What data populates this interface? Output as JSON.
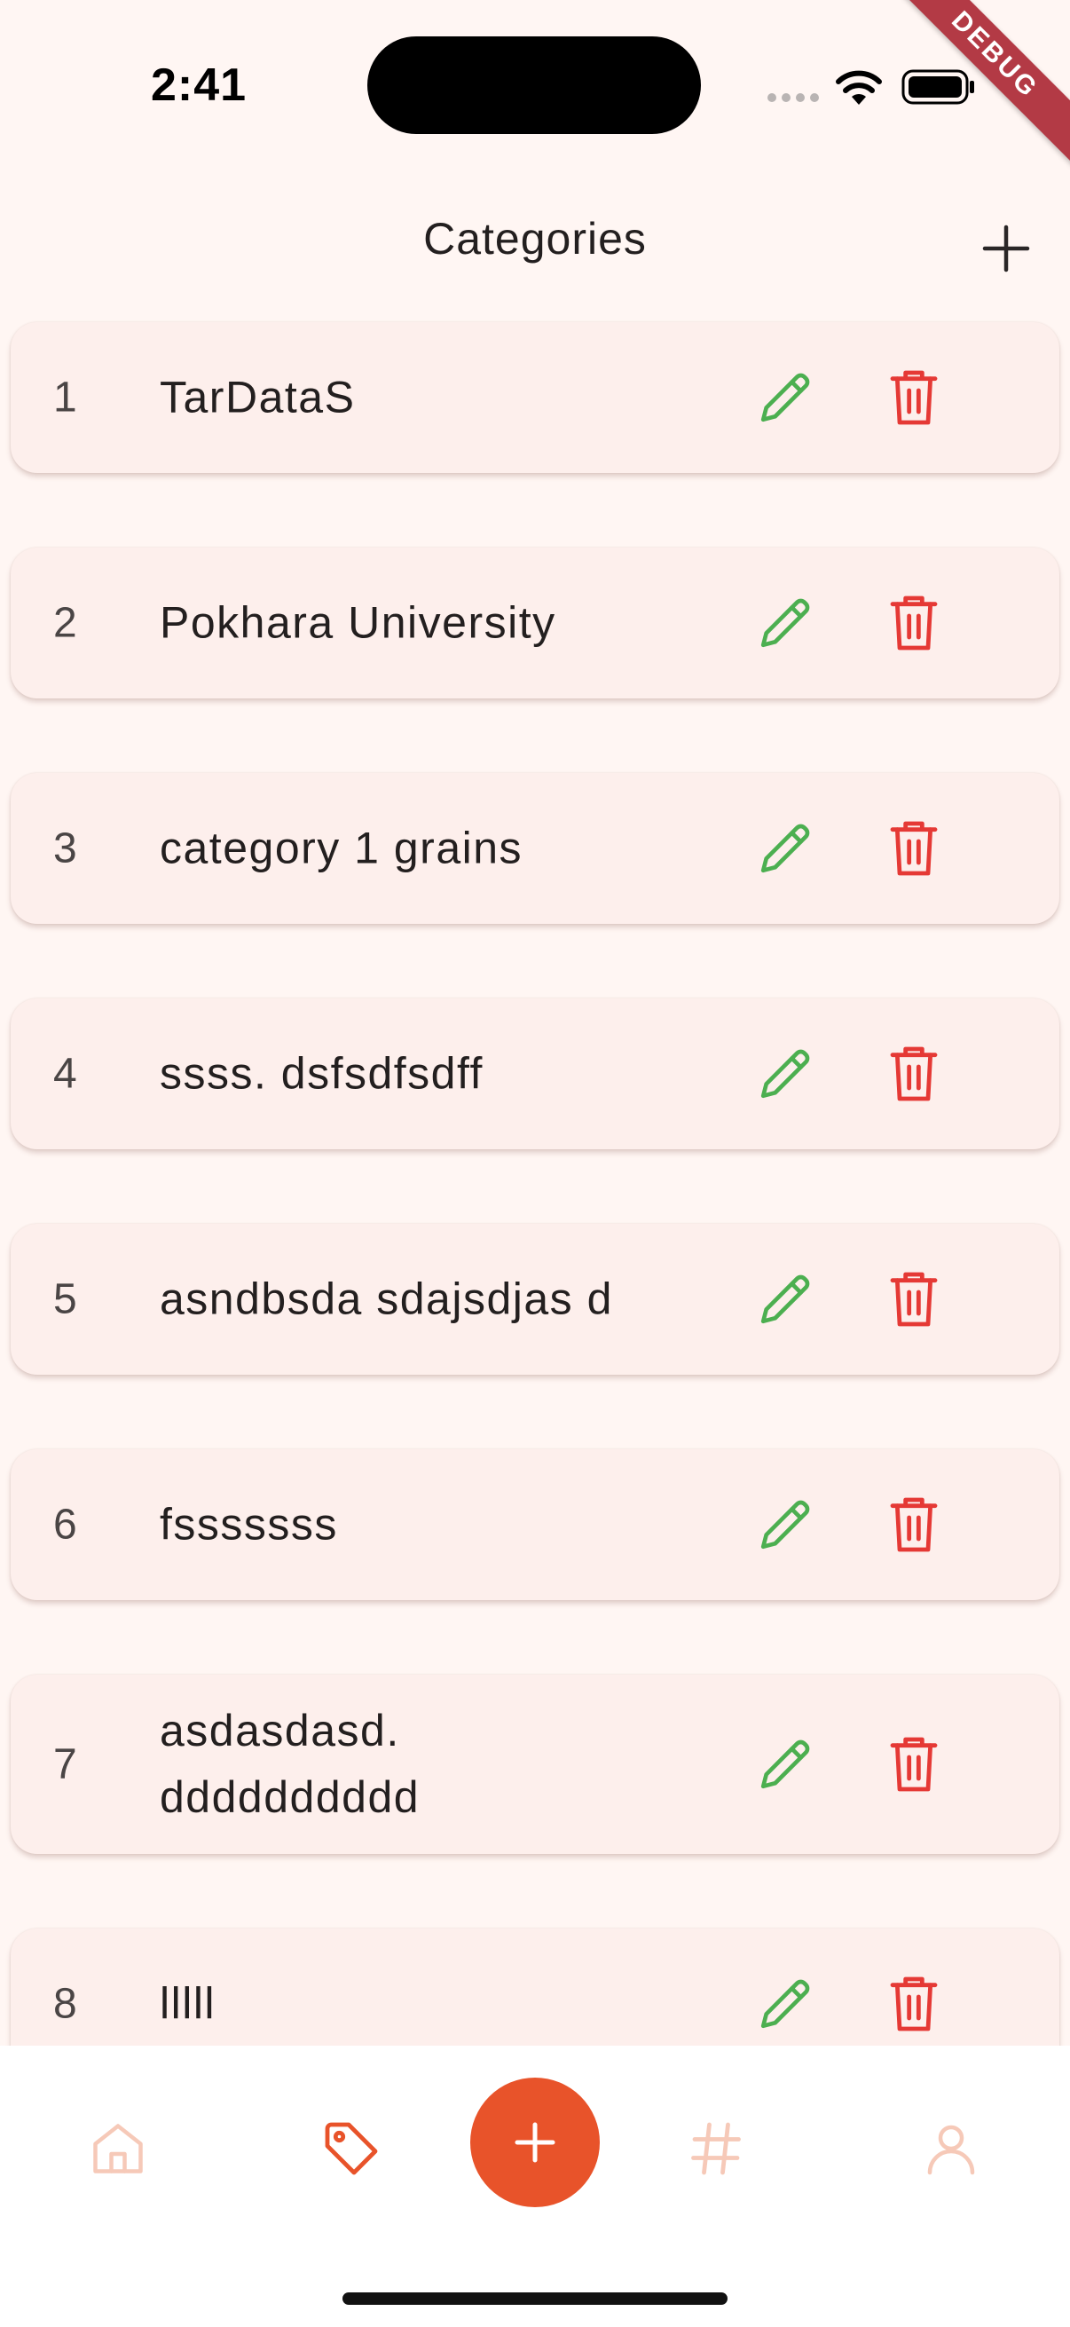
{
  "status_bar": {
    "time": "2:41",
    "debug_label": "DEBUG"
  },
  "app_bar": {
    "title": "Categories",
    "add_icon": "plus-icon"
  },
  "categories": [
    {
      "index": "1",
      "name": "TarDataS"
    },
    {
      "index": "2",
      "name": "Pokhara University"
    },
    {
      "index": "3",
      "name": "category 1 grains"
    },
    {
      "index": "4",
      "name": "ssss. dsfsdfsdff"
    },
    {
      "index": "5",
      "name": "asndbsda sdajsdjas d"
    },
    {
      "index": "6",
      "name": "fsssssss"
    },
    {
      "index": "7",
      "name": "asdasdasd. dddddddddd"
    },
    {
      "index": "8",
      "name": "lllll"
    }
  ],
  "row_icons": {
    "edit": "pencil-icon",
    "delete": "trash-icon"
  },
  "bottom_nav": {
    "items": [
      "home-icon",
      "tag-icon",
      "plus-icon",
      "hashtag-icon",
      "user-icon"
    ],
    "active": "tag-icon"
  },
  "colors": {
    "background": "#fff6f3",
    "card": "#fdefec",
    "accent": "#e8532a",
    "edit": "#4caf50",
    "delete": "#e53935",
    "nav_inactive": "#f6c9b8"
  }
}
